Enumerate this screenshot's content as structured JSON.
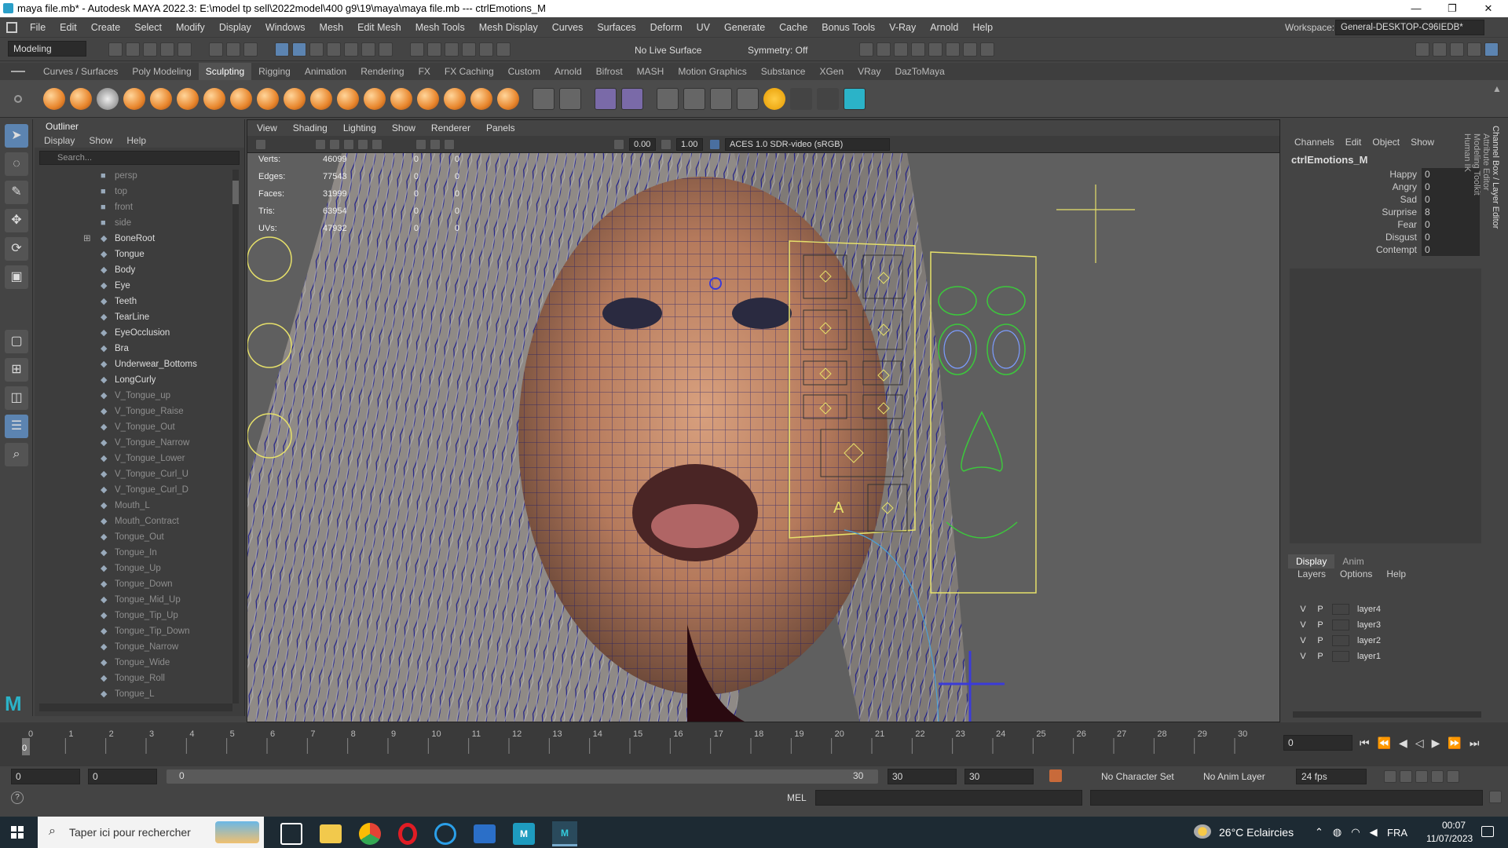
{
  "window": {
    "title": "maya file.mb* - Autodesk MAYA 2022.3: E:\\model tp sell\\2022model\\400 g9\\19\\maya\\maya file.mb  ---  ctrlEmotions_M",
    "minimize": "—",
    "maximize": "❐",
    "close": "✕"
  },
  "menubar": {
    "items": [
      "File",
      "Edit",
      "Create",
      "Select",
      "Modify",
      "Display",
      "Windows",
      "Mesh",
      "Edit Mesh",
      "Mesh Tools",
      "Mesh Display",
      "Curves",
      "Surfaces",
      "Deform",
      "UV",
      "Generate",
      "Cache",
      "Bonus Tools",
      "V-Ray",
      "Arnold",
      "Help"
    ],
    "workspace_label": "Workspace:",
    "workspace_value": "General-DESKTOP-C96IEDB*"
  },
  "statusline": {
    "mode": "Modeling",
    "live_surface": "No Live Surface",
    "symmetry": "Symmetry: Off"
  },
  "shelf": {
    "tabs": [
      "Curves / Surfaces",
      "Poly Modeling",
      "Sculpting",
      "Rigging",
      "Animation",
      "Rendering",
      "FX",
      "FX Caching",
      "Custom",
      "Arnold",
      "Bifrost",
      "MASH",
      "Motion Graphics",
      "Substance",
      "XGen",
      "VRay",
      "DazToMaya"
    ],
    "active_tab": "Sculpting"
  },
  "outliner": {
    "title": "Outliner",
    "menu": [
      "Display",
      "Show",
      "Help"
    ],
    "search_placeholder": "Search...",
    "items": [
      {
        "label": "persp",
        "dim": true
      },
      {
        "label": "top",
        "dim": true
      },
      {
        "label": "front",
        "dim": true
      },
      {
        "label": "side",
        "dim": true
      },
      {
        "label": "BoneRoot",
        "dim": false
      },
      {
        "label": "Tongue",
        "dim": false
      },
      {
        "label": "Body",
        "dim": false
      },
      {
        "label": "Eye",
        "dim": false
      },
      {
        "label": "Teeth",
        "dim": false
      },
      {
        "label": "TearLine",
        "dim": false
      },
      {
        "label": "EyeOcclusion",
        "dim": false
      },
      {
        "label": "Bra",
        "dim": false
      },
      {
        "label": "Underwear_Bottoms",
        "dim": false
      },
      {
        "label": "LongCurly",
        "dim": false
      },
      {
        "label": "V_Tongue_up",
        "dim": true
      },
      {
        "label": "V_Tongue_Raise",
        "dim": true
      },
      {
        "label": "V_Tongue_Out",
        "dim": true
      },
      {
        "label": "V_Tongue_Narrow",
        "dim": true
      },
      {
        "label": "V_Tongue_Lower",
        "dim": true
      },
      {
        "label": "V_Tongue_Curl_U",
        "dim": true
      },
      {
        "label": "V_Tongue_Curl_D",
        "dim": true
      },
      {
        "label": "Mouth_L",
        "dim": true
      },
      {
        "label": "Mouth_Contract",
        "dim": true
      },
      {
        "label": "Tongue_Out",
        "dim": true
      },
      {
        "label": "Tongue_In",
        "dim": true
      },
      {
        "label": "Tongue_Up",
        "dim": true
      },
      {
        "label": "Tongue_Down",
        "dim": true
      },
      {
        "label": "Tongue_Mid_Up",
        "dim": true
      },
      {
        "label": "Tongue_Tip_Up",
        "dim": true
      },
      {
        "label": "Tongue_Tip_Down",
        "dim": true
      },
      {
        "label": "Tongue_Narrow",
        "dim": true
      },
      {
        "label": "Tongue_Wide",
        "dim": true
      },
      {
        "label": "Tongue_Roll",
        "dim": true
      },
      {
        "label": "Tongue_L",
        "dim": true
      }
    ]
  },
  "viewport": {
    "menu": [
      "View",
      "Shading",
      "Lighting",
      "Show",
      "Renderer",
      "Panels"
    ],
    "exposure": "0.00",
    "gamma": "1.00",
    "color_space": "ACES 1.0 SDR-video (sRGB)",
    "stats": [
      {
        "label": "Verts:",
        "value": "46099",
        "a": "0",
        "b": "0"
      },
      {
        "label": "Edges:",
        "value": "77543",
        "a": "0",
        "b": "0"
      },
      {
        "label": "Faces:",
        "value": "31999",
        "a": "0",
        "b": "0"
      },
      {
        "label": "Tris:",
        "value": "63954",
        "a": "0",
        "b": "0"
      },
      {
        "label": "UVs:",
        "value": "47932",
        "a": "0",
        "b": "0"
      }
    ],
    "control_letter": "A"
  },
  "channelbox": {
    "menu": [
      "Channels",
      "Edit",
      "Object",
      "Show"
    ],
    "object": "ctrlEmotions_M",
    "attributes": [
      {
        "name": "Happy",
        "value": "0"
      },
      {
        "name": "Angry",
        "value": "0"
      },
      {
        "name": "Sad",
        "value": "0"
      },
      {
        "name": "Surprise",
        "value": "8"
      },
      {
        "name": "Fear",
        "value": "0"
      },
      {
        "name": "Disgust",
        "value": "0"
      },
      {
        "name": "Contempt",
        "value": "0"
      }
    ],
    "side_tabs": [
      "Channel Box / Layer Editor",
      "Attribute Editor",
      "Modeling Toolkit",
      "Human IK"
    ]
  },
  "layereditor": {
    "tabs": [
      "Display",
      "Anim"
    ],
    "menu": [
      "Layers",
      "Options",
      "Help"
    ],
    "layers": [
      {
        "v": "V",
        "p": "P",
        "name": "layer4"
      },
      {
        "v": "V",
        "p": "P",
        "name": "layer3"
      },
      {
        "v": "V",
        "p": "P",
        "name": "layer2"
      },
      {
        "v": "V",
        "p": "P",
        "name": "layer1"
      }
    ]
  },
  "timeline": {
    "ticks": [
      "0",
      "1",
      "2",
      "3",
      "4",
      "5",
      "6",
      "7",
      "8",
      "9",
      "10",
      "11",
      "12",
      "13",
      "14",
      "15",
      "16",
      "17",
      "18",
      "19",
      "20",
      "21",
      "22",
      "23",
      "24",
      "25",
      "26",
      "27",
      "28",
      "29",
      "30"
    ],
    "current_frame": "0",
    "frame_field": "0"
  },
  "range": {
    "start": "0",
    "start2": "0",
    "slider_start": "0",
    "slider_end": "30",
    "end": "30",
    "end2": "30",
    "character_set": "No Character Set",
    "anim_layer": "No Anim Layer",
    "fps": "24 fps"
  },
  "cmdline": {
    "lang": "MEL"
  },
  "taskbar": {
    "search": "Taper ici pour rechercher",
    "weather": "26°C  Eclaircies",
    "lang": "FRA",
    "time": "00:07",
    "date": "11/07/2023"
  }
}
